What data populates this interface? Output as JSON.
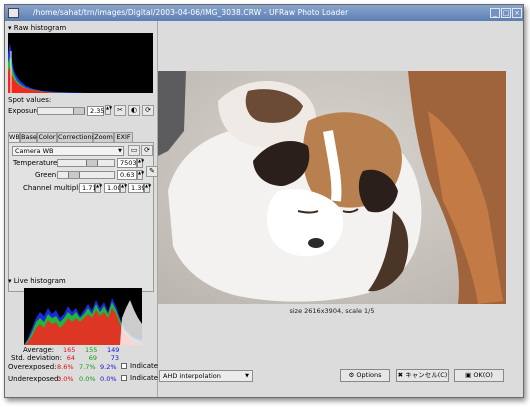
{
  "window": {
    "title": "/home/sahat/trn/images/Digital/2003-04-06/IMG_3038.CRW - UFRaw Photo Loader",
    "minimize_glyph": "_",
    "maximize_glyph": "□",
    "close_glyph": "×"
  },
  "raw_histogram": {
    "header": "Raw histogram"
  },
  "spot_values": {
    "label": "Spot values:"
  },
  "exposure": {
    "label": "Exposure",
    "value": "2.35",
    "slider_level": 0.75
  },
  "tabs": [
    "WB",
    "Base",
    "Color",
    "Corrections",
    "Zoom",
    "EXIF"
  ],
  "white_balance": {
    "preset": "Camera WB",
    "temperature_label": "Temperature",
    "temperature": "7503",
    "temperature_level": 0.55,
    "green_label": "Green",
    "green": "0.63",
    "green_level": 0.25,
    "channel_label": "Channel multipliers",
    "channel_multipliers": [
      "1.71",
      "1.00",
      "1.39"
    ]
  },
  "live_histogram": {
    "header": "Live histogram",
    "average_label": "Average:",
    "average": [
      "165",
      "155",
      "149"
    ],
    "std_label": "Std. deviation:",
    "std_deviation": [
      "64",
      "69",
      "73"
    ],
    "overexposed_label": "Overexposed:",
    "overexposed": [
      "8.6%",
      "7.7%",
      "9.2%"
    ],
    "underexposed_label": "Underexposed:",
    "underexposed": [
      "0.0%",
      "0.0%",
      "0.0%"
    ],
    "indicate_label": "Indicate"
  },
  "image": {
    "caption": "size 2616x3904, scale 1/5"
  },
  "bottom": {
    "interpolation": "AHD interpolation",
    "options_label": "Options",
    "cancel_label": "キャンセル(C)",
    "ok_label": "OK(O)"
  },
  "colors": {
    "titlebar": "#6a8cbd",
    "red": "#e01010",
    "green": "#10a010",
    "blue": "#1010e0"
  }
}
